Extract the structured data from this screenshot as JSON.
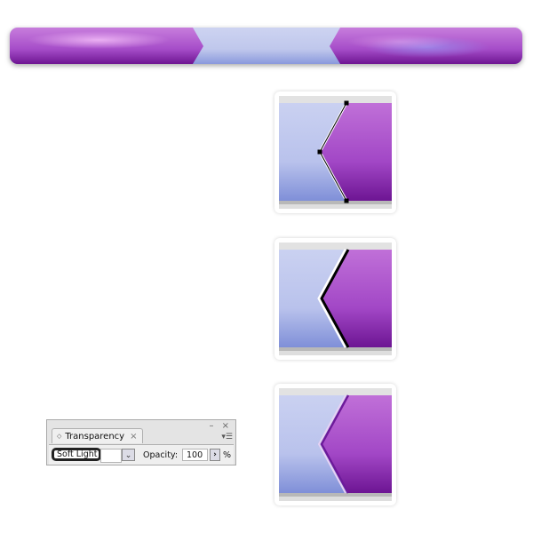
{
  "bar": {
    "colors": {
      "purple": "#b45fd0",
      "purple_dark": "#7a1fa3",
      "blue_light": "#c8cff0",
      "blue_mid": "#8f9de0"
    }
  },
  "steps": [
    {
      "name": "path-selected-with-anchors"
    },
    {
      "name": "path-stroked-black-white"
    },
    {
      "name": "path-soft-light-result"
    }
  ],
  "transparency_panel": {
    "title": "Transparency",
    "tab_arrows": "◇",
    "close_tab": "×",
    "window_buttons": "– ×",
    "menu_icon": "▾☰",
    "blend_mode": "Soft Light",
    "dropdown_icon": "⌄",
    "opacity_label": "Opacity:",
    "opacity_value": "100",
    "opacity_step_icon": "›",
    "opacity_unit": "%"
  }
}
